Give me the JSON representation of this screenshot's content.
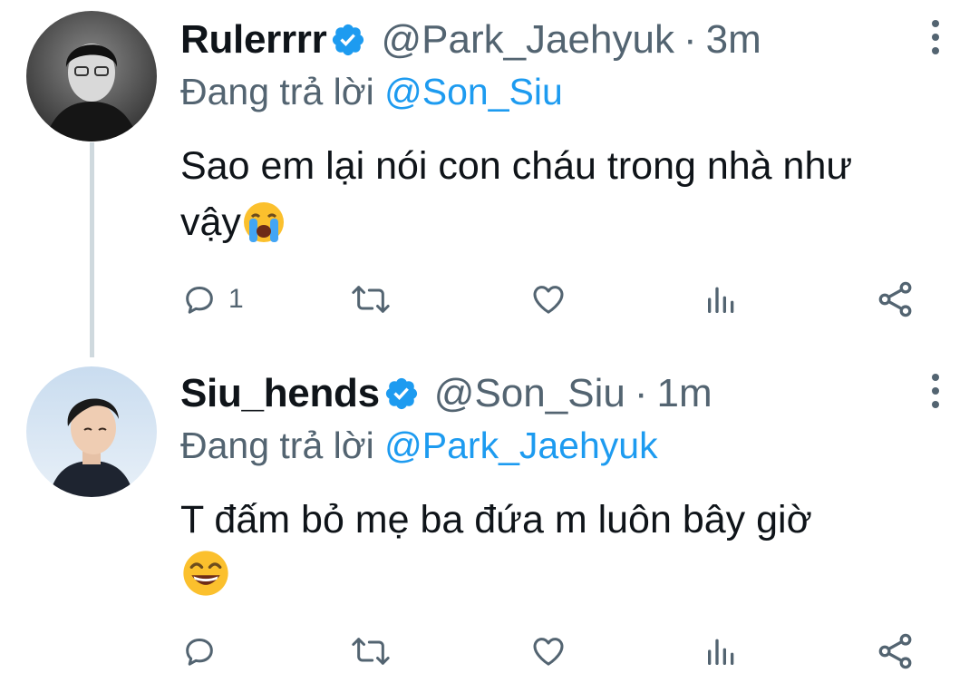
{
  "tweets": [
    {
      "display_name": "Rulerrrr",
      "handle": "@Park_Jaehyuk",
      "separator": "·",
      "time": "3m",
      "replying_prefix": "Đang trả lời",
      "replying_to": "@Son_Siu",
      "text": "Sao em lại nói con cháu trong nhà như vậy",
      "emoji": "loudly-crying-face",
      "reply_count": "1",
      "verified": true
    },
    {
      "display_name": "Siu_hends",
      "handle": "@Son_Siu",
      "separator": "·",
      "time": "1m",
      "replying_prefix": "Đang trả lời",
      "replying_to": "@Park_Jaehyuk",
      "text": "T đấm bỏ mẹ ba đứa m luôn bây giờ",
      "emoji": "grinning-squinting-face",
      "reply_count": "",
      "verified": true
    }
  ],
  "colors": {
    "accent": "#1d9bf0",
    "secondary_text": "#536471",
    "thread_line": "#cfd9de"
  },
  "icons": [
    "reply-icon",
    "retweet-icon",
    "like-icon",
    "analytics-icon",
    "share-icon",
    "more-options-icon",
    "verified-badge-icon"
  ]
}
